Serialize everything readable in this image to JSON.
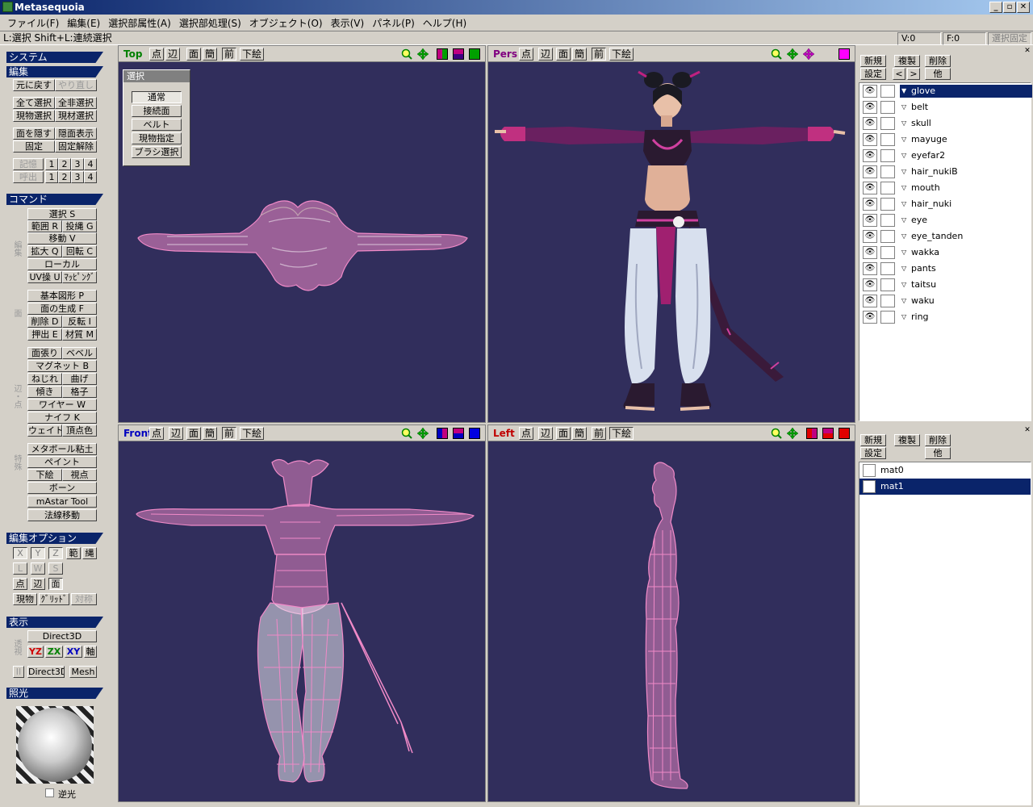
{
  "app": {
    "title": "Metasequoia"
  },
  "menu": [
    "ファイル(F)",
    "編集(E)",
    "選択部属性(A)",
    "選択部処理(S)",
    "オブジェクト(O)",
    "表示(V)",
    "パネル(P)",
    "ヘルプ(H)"
  ],
  "window_buttons": {
    "min": "_",
    "restore": "▫",
    "close": "✕"
  },
  "status": {
    "hint": "L:選択  Shift+L:連続選択",
    "v": "V:0",
    "f": "F:0",
    "fixed": "選択固定"
  },
  "left": {
    "system": "システム",
    "edit": "編集",
    "undo": "元に戻す",
    "redo": "やり直し",
    "select_all": "全て選択",
    "deselect_all": "全非選択",
    "select_obj": "現物選択",
    "select_mat": "現材選択",
    "hide_face": "面を隠す",
    "show_hidden": "隠面表示",
    "fix": "固定",
    "unfix": "固定解除",
    "memory": "記憶",
    "recall": "呼出",
    "nums": [
      "1",
      "2",
      "3",
      "4"
    ],
    "command": "コマンド",
    "grp_edit": "編集",
    "select": "選択 S",
    "range": "範囲 R",
    "lasso": "投縄 G",
    "move": "移動 V",
    "scale": "拡大 Q",
    "rotate": "回転 C",
    "local": "ローカル",
    "uv": "UV操 U",
    "mapping": "ﾏｯﾋﾟﾝｸﾞ",
    "grp_face": "面",
    "primitive": "基本図形 P",
    "gen_face": "面の生成 F",
    "delete": "削除 D",
    "flip": "反転 I",
    "extrude": "押出 E",
    "material": "材質 M",
    "grp_edge": "辺・点",
    "face_stretch": "面張り",
    "bevel": "ベベル",
    "magnet": "マグネット B",
    "twist": "ねじれ",
    "bend": "曲げ",
    "tilt": "傾き",
    "lattice": "格子",
    "wire": "ワイヤー W",
    "knife": "ナイフ K",
    "weight": "ウェイト",
    "vcolor": "頂点色",
    "grp_special": "特殊",
    "metaball": "メタボール粘土",
    "paint": "ペイント",
    "underlay": "下絵",
    "viewpoint": "視点",
    "bone": "ボーン",
    "mastar": "mAstar Tool",
    "normal_move": "法線移動",
    "edit_option": "編集オプション",
    "x": "X",
    "y": "Y",
    "z": "Z",
    "range_opt": "範",
    "lasso_opt": "縄",
    "l": "L",
    "w": "W",
    "s": "S",
    "pt": "点",
    "edge": "辺",
    "face": "面",
    "current_obj": "現物",
    "grid": "ｸﾞﾘｯﾄﾞ",
    "symmetry": "対称",
    "display": "表示",
    "grp_persp": "透視",
    "direct3d": "Direct3D",
    "yz": "YZ",
    "zx": "ZX",
    "xy": "XY",
    "axis": "軸",
    "grp_ii": "II",
    "direct3d_2": "Direct3D",
    "mesh": "Mesh",
    "lighting": "照光",
    "backlight": "逆光"
  },
  "view_buttons": {
    "pt": "点",
    "edge": "辺",
    "face": "面",
    "simple": "簡",
    "front": "前",
    "underlay": "下絵"
  },
  "views": {
    "top": {
      "title": "Top",
      "color": "#008000"
    },
    "pers": {
      "title": "Pers",
      "color": "#800080"
    },
    "front": {
      "title": "Front",
      "color": "#0000c0"
    },
    "left": {
      "title": "Left",
      "color": "#c00000"
    }
  },
  "select_panel": {
    "title": "選択",
    "items": [
      "通常",
      "接続面",
      "ベルト",
      "現物指定",
      "ブラシ選択"
    ]
  },
  "object_panel": {
    "new": "新規",
    "copy": "複製",
    "delete": "削除",
    "settings": "設定",
    "prev": "<",
    "next": ">",
    "other": "他",
    "objects": [
      {
        "name": "glove",
        "selected": true
      },
      {
        "name": "belt"
      },
      {
        "name": "skull"
      },
      {
        "name": "mayuge"
      },
      {
        "name": "eyefar2"
      },
      {
        "name": "hair_nukiB"
      },
      {
        "name": "mouth"
      },
      {
        "name": "hair_nuki"
      },
      {
        "name": "eye"
      },
      {
        "name": "eye_tanden"
      },
      {
        "name": "wakka"
      },
      {
        "name": "pants"
      },
      {
        "name": "taitsu"
      },
      {
        "name": "waku"
      },
      {
        "name": "ring"
      }
    ]
  },
  "material_panel": {
    "new": "新規",
    "copy": "複製",
    "delete": "削除",
    "settings": "設定",
    "other": "他",
    "materials": [
      {
        "name": "mat0"
      },
      {
        "name": "mat1",
        "selected": true
      }
    ]
  },
  "colors": {
    "viewport_bg": "#312e5c",
    "wire": "#f08ac8",
    "selection": "#0a246a"
  }
}
